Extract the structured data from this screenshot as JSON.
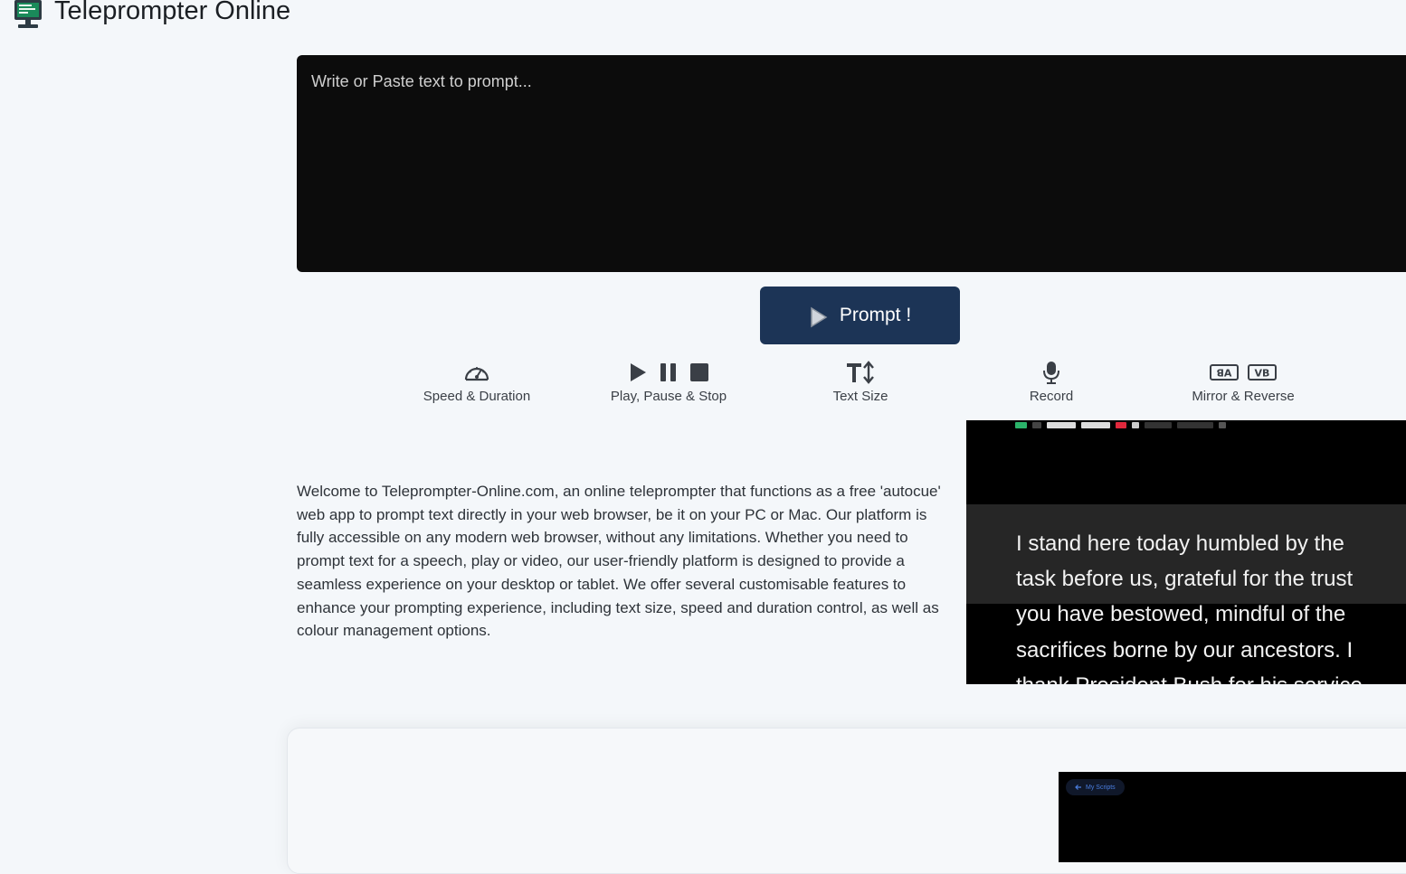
{
  "header": {
    "title": "Teleprompter Online",
    "logo_icon": "monitor-icon"
  },
  "editor": {
    "placeholder": "Write or Paste text to prompt..."
  },
  "prompt_button": {
    "label": "Prompt !",
    "icon": "play-icon",
    "bg_color": "#1c3456"
  },
  "features": [
    {
      "label": "Speed & Duration",
      "icons": [
        "speedometer-icon"
      ]
    },
    {
      "label": "Play, Pause & Stop",
      "icons": [
        "play-icon",
        "pause-icon",
        "stop-icon"
      ]
    },
    {
      "label": "Text Size",
      "icons": [
        "text-size-icon"
      ]
    },
    {
      "label": "Record",
      "icons": [
        "microphone-icon"
      ]
    },
    {
      "label": "Mirror & Reverse",
      "icons": [
        "mirror-icon",
        "reverse-icon"
      ]
    }
  ],
  "welcome_text": "Welcome to Teleprompter-Online.com, an online teleprompter that functions as a free 'autocue' web app to prompt text directly in your web browser, be it on your PC or Mac. Our platform is fully accessible on any modern web browser, without any limitations. Whether you need to prompt text for a speech, play or video, our user-friendly platform is designed to provide a seamless experience on your desktop or tablet. We offer several customisable features to enhance your prompting experience, including text size, speed and duration control, as well as colour management options.",
  "preview": {
    "script_text": "I stand here today humbled by the task before us, grateful for the trust you have bestowed, mindful of the sacrifices borne by our ancestors. I thank President Bush for his service"
  },
  "preview2": {
    "back_label": "My Scripts"
  }
}
